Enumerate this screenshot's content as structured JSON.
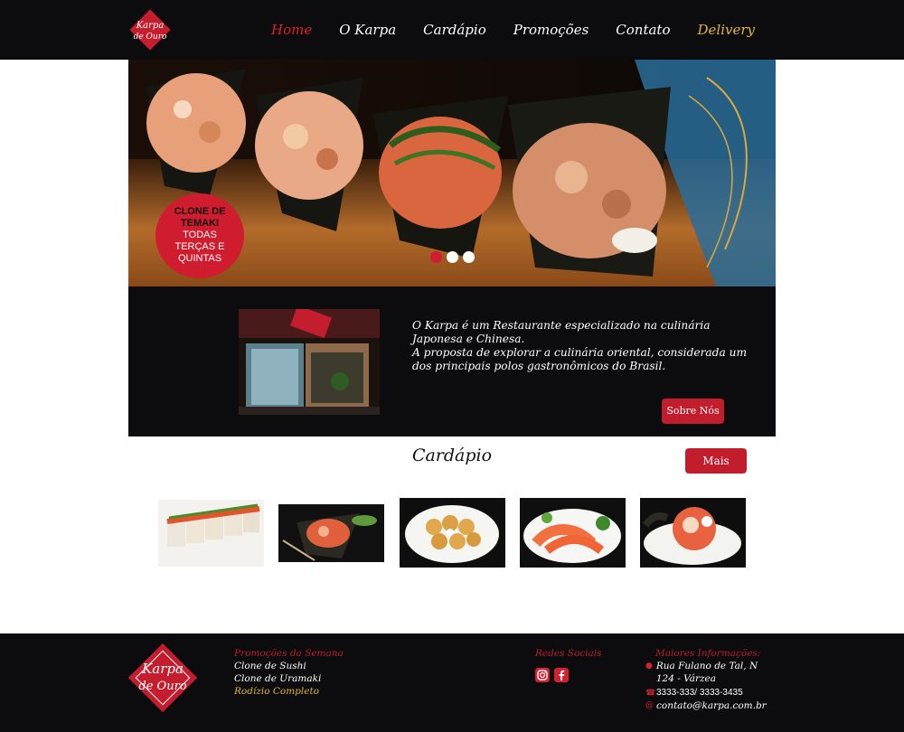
{
  "header": {
    "logo_text": "KARPA DE OURO",
    "nav": [
      {
        "label": "Home",
        "active": true
      },
      {
        "label": "O Karpa"
      },
      {
        "label": "Cardápio"
      },
      {
        "label": "Promoções"
      },
      {
        "label": "Contato"
      },
      {
        "label": "Delivery",
        "highlight": true
      }
    ]
  },
  "hero": {
    "promo_line1": "CLONE DE",
    "promo_line2": "TEMAKI",
    "promo_line3": "TODAS",
    "promo_line4": "TERÇAS E",
    "promo_line5": "QUINTAS",
    "slides_count": 3,
    "active_slide": 1
  },
  "about": {
    "text_1": "O Karpa é um Restaurante especializado na culinária Japonesa e Chinesa.",
    "text_2": "A proposta de explorar a culinária oriental, considerada um dos principais polos gastronômicos do Brasil.",
    "button": "Sobre Nós"
  },
  "menu_section": {
    "title": "Cardápio",
    "button": "Mais"
  },
  "footer": {
    "promos_title": "Promoções da Semana",
    "promos": [
      "Clone de Sushi",
      "Clone de Uramaki"
    ],
    "promos_highlight": "Rodízio Completo",
    "social_title": "Redes Sociais",
    "info_title": "Maiores Informações:",
    "address": "Rua Fulano de Tal, N 124 - Várzea",
    "phone": "3333-333/ 3333-3435",
    "email": "contato@karpa.com.br"
  },
  "colors": {
    "brand_red": "#cf1d2f",
    "gold": "#e2b731",
    "dark": "#0c0c0e"
  }
}
